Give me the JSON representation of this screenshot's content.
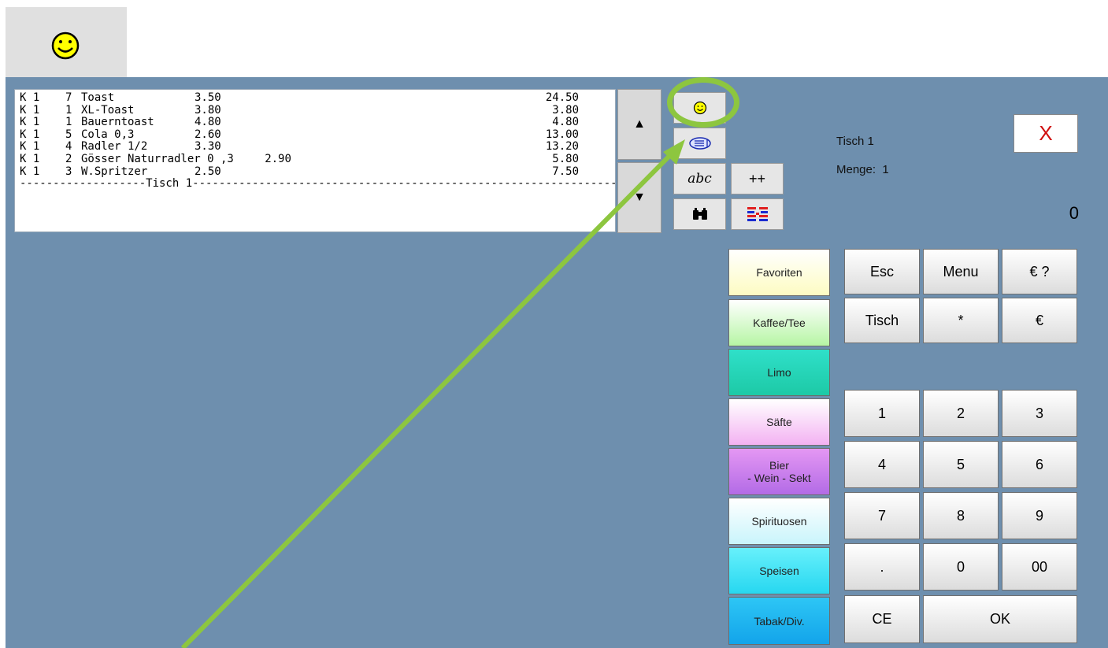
{
  "icons": {
    "top_smiley": "smiley-face-icon",
    "scroll_up": "▲",
    "scroll_down": "▼",
    "small_smiley": "smiley-face-icon",
    "receipt": "receipt-icon",
    "binoculars": "binoculars-icon",
    "flag": "flag-icon"
  },
  "colors": {
    "background": "#6e8fae",
    "highlight": "#8dc63f",
    "close_x": "#d01010"
  },
  "order": {
    "rows": [
      {
        "k": "K 1",
        "qty": "7",
        "name": "Toast",
        "price": "3.50",
        "total": "24.50"
      },
      {
        "k": "K 1",
        "qty": "1",
        "name": "XL-Toast",
        "price": "3.80",
        "total": "3.80"
      },
      {
        "k": "K 1",
        "qty": "1",
        "name": "Bauerntoast",
        "price": "4.80",
        "total": "4.80"
      },
      {
        "k": "K 1",
        "qty": "5",
        "name": "Cola 0,3",
        "price": "2.60",
        "total": "13.00"
      },
      {
        "k": "K 1",
        "qty": "4",
        "name": "Radler 1/2",
        "price": "3.30",
        "total": "13.20"
      },
      {
        "k": "K 1",
        "qty": "2",
        "name": "Gösser Naturradler 0 ,3",
        "price": "2.90",
        "total": "5.80"
      },
      {
        "k": "K 1",
        "qty": "3",
        "name": "W.Spritzer",
        "price": "2.50",
        "total": "7.50"
      }
    ],
    "separator": "-------------------Tisch 1------------------------------------------------------------------------------"
  },
  "tools": {
    "abc": "abc",
    "plusplus": "++"
  },
  "info": {
    "table": "Tisch 1",
    "quantity": "Menge:  1",
    "close": "X",
    "amount": "0"
  },
  "categories": [
    {
      "label": "Favoriten"
    },
    {
      "label": "Kaffee/Tee"
    },
    {
      "label": "Limo"
    },
    {
      "label": "Säfte"
    },
    {
      "label": "Bier\n- Wein - Sekt"
    },
    {
      "label": "Spirituosen"
    },
    {
      "label": "Speisen"
    },
    {
      "label": "Tabak/Div."
    }
  ],
  "keys": {
    "esc": "Esc",
    "menu": "Menu",
    "euro_query": "€ ?",
    "tisch": "Tisch",
    "star": "*",
    "euro": "€",
    "k1": "1",
    "k2": "2",
    "k3": "3",
    "k4": "4",
    "k5": "5",
    "k6": "6",
    "k7": "7",
    "k8": "8",
    "k9": "9",
    "dot": ".",
    "k0": "0",
    "k00": "00",
    "ce": "CE",
    "ok": "OK"
  }
}
